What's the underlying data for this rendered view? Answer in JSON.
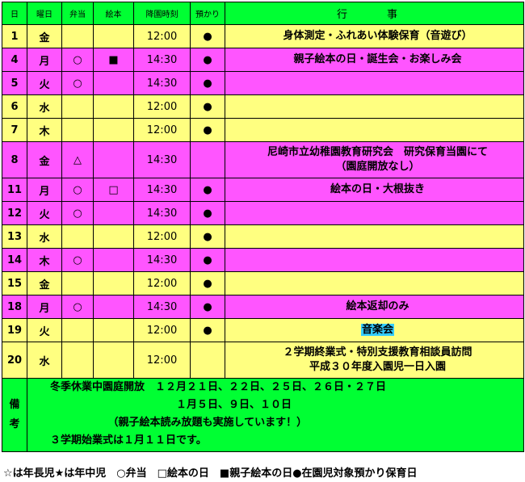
{
  "headers": {
    "date": "日",
    "weekday": "曜日",
    "lunch": "弁当",
    "picture_book": "絵本",
    "dismissal_time": "降園時刻",
    "childcare": "預かり",
    "events": "行　事"
  },
  "rows": [
    {
      "date": "1",
      "weekday": "金",
      "lunch": "",
      "book": "",
      "time": "12:00",
      "care": "●",
      "events": [
        "身体測定・ふれあい体験保育（音遊び）"
      ],
      "color": "yellow"
    },
    {
      "date": "4",
      "weekday": "月",
      "lunch": "○",
      "book": "■",
      "time": "14:30",
      "care": "●",
      "events": [
        "親子絵本の日・誕生会・お楽しみ会"
      ],
      "color": "pink"
    },
    {
      "date": "5",
      "weekday": "火",
      "lunch": "○",
      "book": "",
      "time": "14:30",
      "care": "●",
      "events": [],
      "color": "pink"
    },
    {
      "date": "6",
      "weekday": "水",
      "lunch": "",
      "book": "",
      "time": "12:00",
      "care": "●",
      "events": [],
      "color": "yellow"
    },
    {
      "date": "7",
      "weekday": "木",
      "lunch": "",
      "book": "",
      "time": "12:00",
      "care": "●",
      "events": [],
      "color": "yellow"
    },
    {
      "date": "8",
      "weekday": "金",
      "lunch": "△",
      "book": "",
      "time": "14:30",
      "care": "",
      "events": [
        "尼崎市立幼稚園教育研究会　研究保育当園にて",
        "（園庭開放なし）"
      ],
      "color": "pink"
    },
    {
      "date": "11",
      "weekday": "月",
      "lunch": "○",
      "book": "□",
      "time": "14:30",
      "care": "●",
      "events": [
        "絵本の日・大根抜き"
      ],
      "color": "pink"
    },
    {
      "date": "12",
      "weekday": "火",
      "lunch": "○",
      "book": "",
      "time": "14:30",
      "care": "●",
      "events": [],
      "color": "pink"
    },
    {
      "date": "13",
      "weekday": "水",
      "lunch": "",
      "book": "",
      "time": "12:00",
      "care": "●",
      "events": [],
      "color": "yellow"
    },
    {
      "date": "14",
      "weekday": "木",
      "lunch": "○",
      "book": "",
      "time": "14:30",
      "care": "●",
      "events": [],
      "color": "pink"
    },
    {
      "date": "15",
      "weekday": "金",
      "lunch": "",
      "book": "",
      "time": "12:00",
      "care": "●",
      "events": [],
      "color": "yellow"
    },
    {
      "date": "18",
      "weekday": "月",
      "lunch": "○",
      "book": "",
      "time": "14:30",
      "care": "●",
      "events": [
        "絵本返却のみ"
      ],
      "color": "pink"
    },
    {
      "date": "19",
      "weekday": "火",
      "lunch": "",
      "book": "",
      "time": "12:00",
      "care": "●",
      "events": [
        "音楽会"
      ],
      "highlight": true,
      "color": "yellow"
    },
    {
      "date": "20",
      "weekday": "水",
      "lunch": "",
      "book": "",
      "time": "12:00",
      "care": "",
      "events": [
        "２学期終業式・特別支援教育相談員訪問",
        "平成３０年度入園児一日入園"
      ],
      "color": "yellow"
    }
  ],
  "remarks": {
    "label": "備考",
    "lines": [
      "冬季休業中園庭開放　１２月２１日、２２日、２５日、２６日・２７日",
      "　　　　　　　　　　　　１月５日、９日、１０日",
      "　　　　　　（親子絵本読み放題も実施しています！）",
      "３学期始業式は１月１１日です。"
    ]
  },
  "legend": "☆は年長児★は年中児　○弁当　□絵本の日　■親子絵本の日●在園児対象預かり保育日",
  "colors": {
    "header_green": "#00ff33",
    "row_yellow": "#ffff80",
    "row_pink": "#ff55ff",
    "highlight_blue": "#33ccff"
  }
}
